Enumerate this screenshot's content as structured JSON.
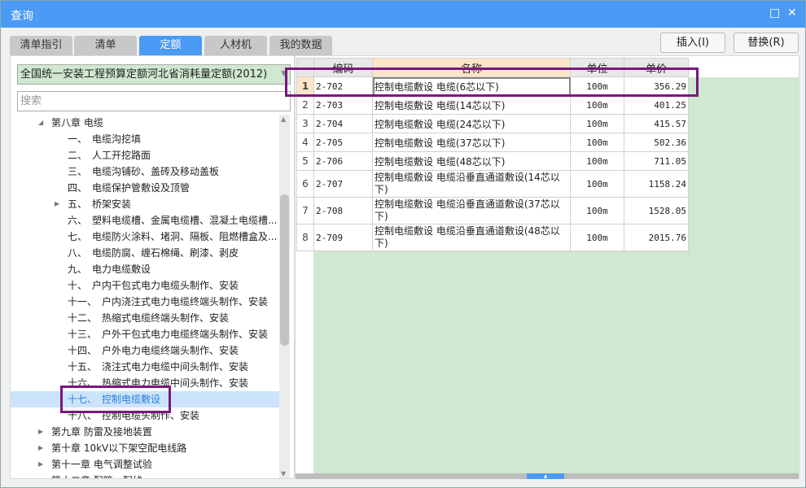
{
  "window": {
    "title": "查询",
    "maximize_icon": "□",
    "close_icon": "✕"
  },
  "tabs": [
    {
      "label": "清单指引"
    },
    {
      "label": "清单"
    },
    {
      "label": "定额",
      "active": true
    },
    {
      "label": "人材机"
    },
    {
      "label": "我的数据"
    }
  ],
  "buttons": {
    "insert": "插入(I)",
    "replace": "替换(R)"
  },
  "library": {
    "selected": "全国统一安装工程预算定额河北省消耗量定额(2012)"
  },
  "search": {
    "placeholder": "搜索",
    "value": ""
  },
  "tree": [
    {
      "label": "第八章 电缆",
      "level": 0,
      "expanded": true
    },
    {
      "label": "一、　电缆沟挖填",
      "level": 1
    },
    {
      "label": "二、　人工开挖路面",
      "level": 1
    },
    {
      "label": "三、　电缆沟铺砂、盖砖及移动盖板",
      "level": 1
    },
    {
      "label": "四、　电缆保护管敷设及顶管",
      "level": 1
    },
    {
      "label": "五、　桥架安装",
      "level": 1,
      "collapsed": true
    },
    {
      "label": "六、　塑料电缆槽、金属电缆槽、混凝土电缆槽...",
      "level": 1
    },
    {
      "label": "七、　电缆防火涂料、堵洞、隔板、阻燃槽盒及...",
      "level": 1
    },
    {
      "label": "八、　电缆防腐、缠石棉绳、刷漆、剥皮",
      "level": 1
    },
    {
      "label": "九、　电力电缆敷设",
      "level": 1
    },
    {
      "label": "十、　户内干包式电力电缆头制作、安装",
      "level": 1
    },
    {
      "label": "十一、　户内浇注式电力电缆终端头制作、安装",
      "level": 1
    },
    {
      "label": "十二、　热缩式电缆终端头制作、安装",
      "level": 1
    },
    {
      "label": "十三、　户外干包式电力电缆终端头制作、安装",
      "level": 1
    },
    {
      "label": "十四、　户外电力电缆终端头制作、安装",
      "level": 1
    },
    {
      "label": "十五、　浇注式电力电缆中间头制作、安装",
      "level": 1
    },
    {
      "label": "十六、　热缩式电力电缆中间头制作、安装",
      "level": 1
    },
    {
      "label": "十七、　控制电缆敷设",
      "level": 1,
      "selected": true
    },
    {
      "label": "十八、　控制电缆头制作、安装",
      "level": 1
    },
    {
      "label": "第九章 防雷及接地装置",
      "level": 0,
      "collapsed": true
    },
    {
      "label": "第十章 10kV以下架空配电线路",
      "level": 0,
      "collapsed": true
    },
    {
      "label": "第十一章 电气调整试验",
      "level": 0,
      "collapsed": true
    },
    {
      "label": "第十二章 配管、配线",
      "level": 0,
      "collapsed": true
    }
  ],
  "grid": {
    "headers": [
      "",
      "编码",
      "名称",
      "单位",
      "单价"
    ],
    "rows": [
      {
        "n": "1",
        "code": "2-702",
        "name": "控制电缆敷设 电缆(6芯以下)",
        "unit": "100m",
        "price": "356.29"
      },
      {
        "n": "2",
        "code": "2-703",
        "name": "控制电缆敷设 电缆(14芯以下)",
        "unit": "100m",
        "price": "401.25"
      },
      {
        "n": "3",
        "code": "2-704",
        "name": "控制电缆敷设 电缆(24芯以下)",
        "unit": "100m",
        "price": "415.57"
      },
      {
        "n": "4",
        "code": "2-705",
        "name": "控制电缆敷设 电缆(37芯以下)",
        "unit": "100m",
        "price": "502.36"
      },
      {
        "n": "5",
        "code": "2-706",
        "name": "控制电缆敷设 电缆(48芯以下)",
        "unit": "100m",
        "price": "711.05"
      },
      {
        "n": "6",
        "code": "2-707",
        "name": "控制电缆敷设 电缆沿垂直通道敷设(14芯以下)",
        "unit": "100m",
        "price": "1158.24"
      },
      {
        "n": "7",
        "code": "2-708",
        "name": "控制电缆敷设 电缆沿垂直通道敷设(37芯以下)",
        "unit": "100m",
        "price": "1528.05"
      },
      {
        "n": "8",
        "code": "2-709",
        "name": "控制电缆敷设 电缆沿垂直通道敷设(48芯以下)",
        "unit": "100m",
        "price": "2015.76"
      }
    ]
  },
  "colors": {
    "accent": "#4a9af6",
    "highlight": "#7a1680",
    "grid_bg": "#cfe8cf"
  }
}
